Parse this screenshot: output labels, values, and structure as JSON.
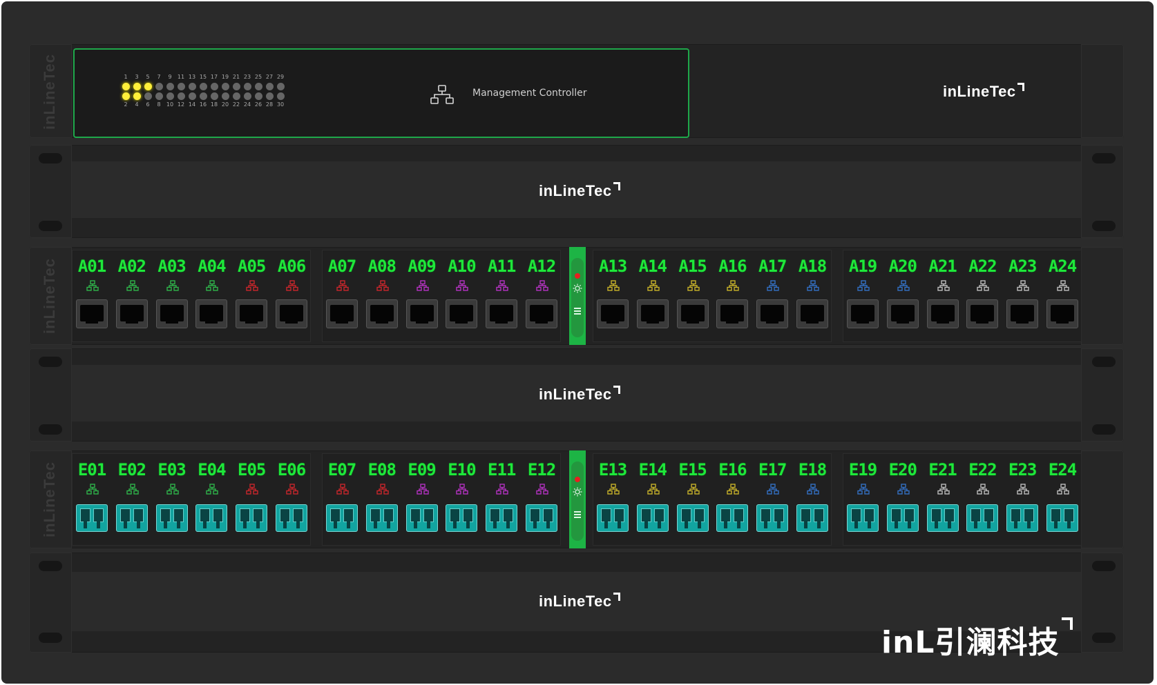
{
  "brand": {
    "logo_text": "inLineTec",
    "badge_prefix": "inL",
    "badge_cn": "引澜科技"
  },
  "management": {
    "label": "Management Controller",
    "led_top_numbers": [
      "1",
      "3",
      "5",
      "7",
      "9",
      "11",
      "13",
      "15",
      "17",
      "19",
      "21",
      "23",
      "25",
      "27",
      "29"
    ],
    "led_bottom_numbers": [
      "2",
      "4",
      "6",
      "8",
      "10",
      "12",
      "14",
      "16",
      "18",
      "20",
      "22",
      "24",
      "26",
      "28",
      "30"
    ],
    "led_states_top": [
      true,
      true,
      true,
      false,
      false,
      false,
      false,
      false,
      false,
      false,
      false,
      false,
      false,
      false,
      false
    ],
    "led_states_bottom": [
      true,
      true,
      false,
      false,
      false,
      false,
      false,
      false,
      false,
      false,
      false,
      false,
      false,
      false,
      false
    ],
    "led_on_color": "#ffef3a",
    "led_off_color": "#666666",
    "border_color": "#1ea84a",
    "icon": "network-topology-icon"
  },
  "colors": {
    "label_green": "#1ee83a",
    "controller_green": "#1db445",
    "status_red": "#e62020"
  },
  "panel_a": {
    "connector": "rj45",
    "ports": [
      {
        "label": "A01",
        "icon_color": "#2fb34a"
      },
      {
        "label": "A02",
        "icon_color": "#2fb34a"
      },
      {
        "label": "A03",
        "icon_color": "#2fb34a"
      },
      {
        "label": "A04",
        "icon_color": "#2fb34a"
      },
      {
        "label": "A05",
        "icon_color": "#c8262b"
      },
      {
        "label": "A06",
        "icon_color": "#c8262b"
      },
      {
        "label": "A07",
        "icon_color": "#c8262b"
      },
      {
        "label": "A08",
        "icon_color": "#c8262b"
      },
      {
        "label": "A09",
        "icon_color": "#b532c2"
      },
      {
        "label": "A10",
        "icon_color": "#b532c2"
      },
      {
        "label": "A11",
        "icon_color": "#b532c2"
      },
      {
        "label": "A12",
        "icon_color": "#b532c2"
      },
      {
        "label": "A13",
        "icon_color": "#c7b22a"
      },
      {
        "label": "A14",
        "icon_color": "#c7b22a"
      },
      {
        "label": "A15",
        "icon_color": "#c7b22a"
      },
      {
        "label": "A16",
        "icon_color": "#c7b22a"
      },
      {
        "label": "A17",
        "icon_color": "#3370c4"
      },
      {
        "label": "A18",
        "icon_color": "#3370c4"
      },
      {
        "label": "A19",
        "icon_color": "#3370c4"
      },
      {
        "label": "A20",
        "icon_color": "#3370c4"
      },
      {
        "label": "A21",
        "icon_color": "#bdbdbd"
      },
      {
        "label": "A22",
        "icon_color": "#bdbdbd"
      },
      {
        "label": "A23",
        "icon_color": "#bdbdbd"
      },
      {
        "label": "A24",
        "icon_color": "#bdbdbd"
      }
    ]
  },
  "panel_e": {
    "connector": "lc-duplex",
    "ports": [
      {
        "label": "E01",
        "icon_color": "#2fb34a"
      },
      {
        "label": "E02",
        "icon_color": "#2fb34a"
      },
      {
        "label": "E03",
        "icon_color": "#2fb34a"
      },
      {
        "label": "E04",
        "icon_color": "#2fb34a"
      },
      {
        "label": "E05",
        "icon_color": "#c8262b"
      },
      {
        "label": "E06",
        "icon_color": "#c8262b"
      },
      {
        "label": "E07",
        "icon_color": "#c8262b"
      },
      {
        "label": "E08",
        "icon_color": "#c8262b"
      },
      {
        "label": "E09",
        "icon_color": "#b532c2"
      },
      {
        "label": "E10",
        "icon_color": "#b532c2"
      },
      {
        "label": "E11",
        "icon_color": "#b532c2"
      },
      {
        "label": "E12",
        "icon_color": "#b532c2"
      },
      {
        "label": "E13",
        "icon_color": "#c7b22a"
      },
      {
        "label": "E14",
        "icon_color": "#c7b22a"
      },
      {
        "label": "E15",
        "icon_color": "#c7b22a"
      },
      {
        "label": "E16",
        "icon_color": "#c7b22a"
      },
      {
        "label": "E17",
        "icon_color": "#3370c4"
      },
      {
        "label": "E18",
        "icon_color": "#3370c4"
      },
      {
        "label": "E19",
        "icon_color": "#3370c4"
      },
      {
        "label": "E20",
        "icon_color": "#3370c4"
      },
      {
        "label": "E21",
        "icon_color": "#bdbdbd"
      },
      {
        "label": "E22",
        "icon_color": "#bdbdbd"
      },
      {
        "label": "E23",
        "icon_color": "#bdbdbd"
      },
      {
        "label": "E24",
        "icon_color": "#bdbdbd"
      }
    ]
  }
}
